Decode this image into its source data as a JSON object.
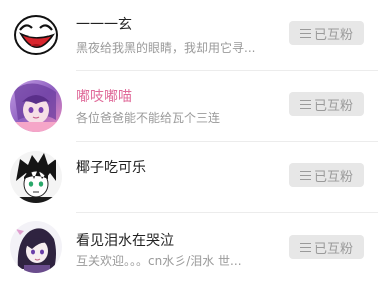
{
  "users": [
    {
      "name": "一一一玄",
      "signature": "黑夜给我黑的眼睛，我却用它寻...",
      "avatar_icon": "meme-face-avatar",
      "follow_label": "已互粉"
    },
    {
      "name": "嘟吱嘟喵",
      "signature": "各位爸爸能不能给瓦个三连",
      "avatar_icon": "anime-girl-pink-avatar",
      "follow_label": "已互粉"
    },
    {
      "name": "椰子吃可乐",
      "signature": "",
      "avatar_icon": "anime-boy-sketch-avatar",
      "follow_label": "已互粉"
    },
    {
      "name": "看见泪水在哭泣",
      "signature": "互关欢迎。。。cn水彡/泪水 世...",
      "avatar_icon": "anime-girl-purple-avatar",
      "follow_label": "已互粉"
    }
  ],
  "colors": {
    "name_default": "#222222",
    "name_vip": "#e06b9a",
    "button_bg": "#e7e7e7",
    "button_text": "#9a9a9a"
  }
}
